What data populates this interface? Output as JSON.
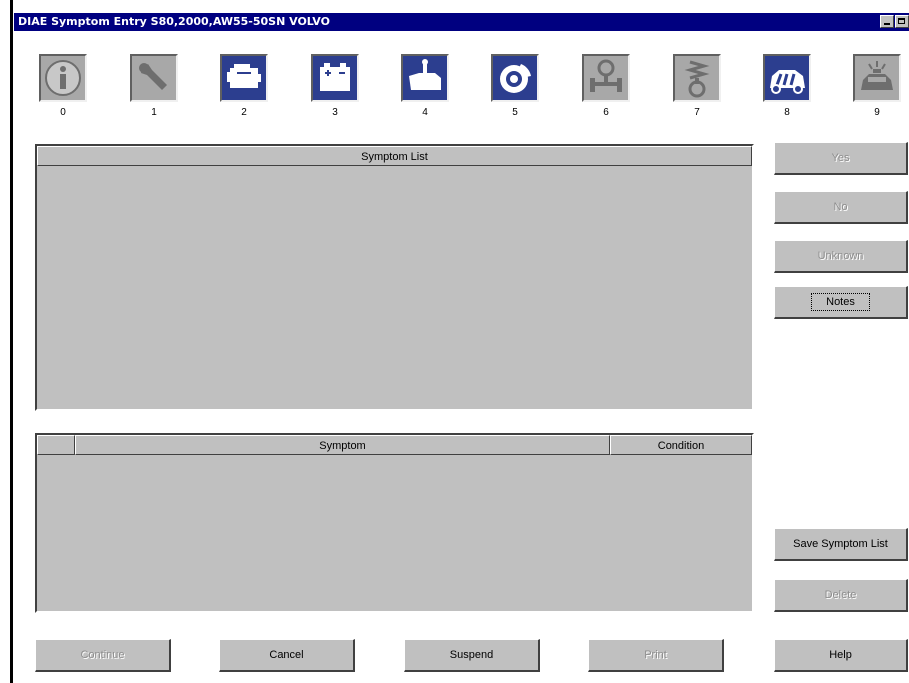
{
  "window": {
    "title": "DIAE Symptom Entry S80,2000,AW55-50SN VOLVO"
  },
  "icons": [
    {
      "number": "0",
      "name": "info-icon",
      "state": "inactive"
    },
    {
      "number": "1",
      "name": "wrench-icon",
      "state": "inactive"
    },
    {
      "number": "2",
      "name": "engine-icon",
      "state": "active"
    },
    {
      "number": "3",
      "name": "battery-icon",
      "state": "active"
    },
    {
      "number": "4",
      "name": "transmission-icon",
      "state": "active"
    },
    {
      "number": "5",
      "name": "brake-icon",
      "state": "active"
    },
    {
      "number": "6",
      "name": "steering-icon",
      "state": "inactive"
    },
    {
      "number": "7",
      "name": "suspension-icon",
      "state": "inactive"
    },
    {
      "number": "8",
      "name": "car-interior-icon",
      "state": "active"
    },
    {
      "number": "9",
      "name": "car-lamp-icon",
      "state": "inactive"
    }
  ],
  "symptom_list": {
    "header": "Symptom List"
  },
  "symptom_table": {
    "columns": [
      "",
      "Symptom",
      "Condition"
    ]
  },
  "side_buttons": {
    "yes": "Yes",
    "no": "No",
    "unknown": "Unknown",
    "notes": "Notes",
    "save": "Save Symptom List",
    "delete": "Delete"
  },
  "bottom_buttons": {
    "continue": "Continue",
    "cancel": "Cancel",
    "suspend": "Suspend",
    "print": "Print",
    "help": "Help"
  },
  "colors": {
    "titlebar": "#000080",
    "active_icon": "#2c3e8f",
    "face": "#c0c0c0"
  }
}
